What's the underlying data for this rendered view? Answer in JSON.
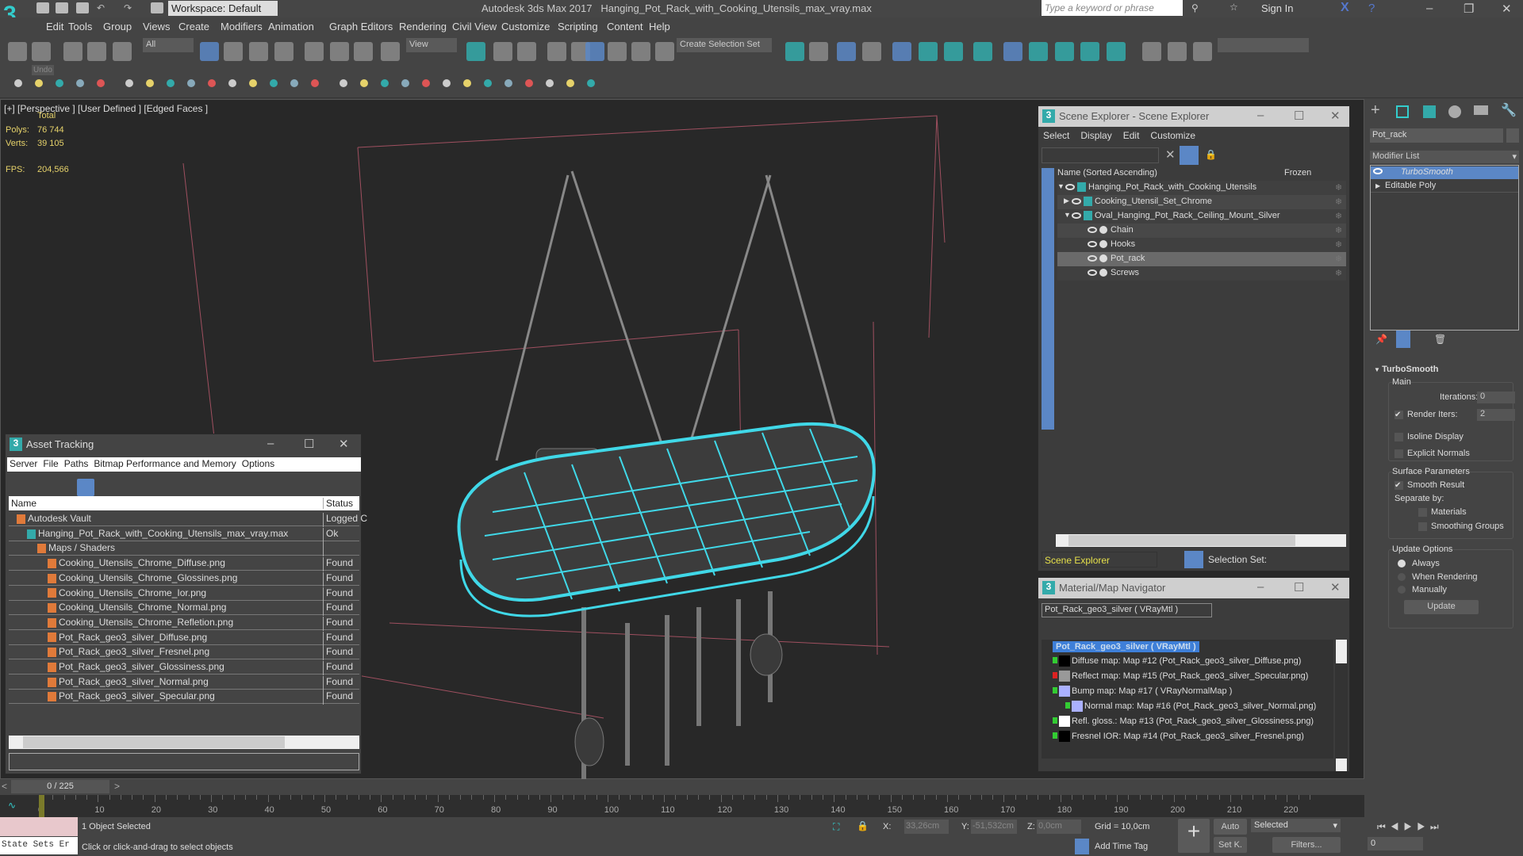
{
  "titlebar": {
    "workspace": "Workspace: Default",
    "app_title": "Autodesk 3ds Max 2017",
    "file_title": "Hanging_Pot_Rack_with_Cooking_Utensils_max_vray.max",
    "search_placeholder": "Type a keyword or phrase",
    "sign_in": "Sign In",
    "logo": "3"
  },
  "menu": [
    "Edit",
    "Tools",
    "Group",
    "Views",
    "Create",
    "Modifiers",
    "Animation",
    "Graph Editors",
    "Rendering",
    "Civil View",
    "Customize",
    "Scripting",
    "Content",
    "Help"
  ],
  "toolbar": {
    "filter": "All",
    "ref_coord": "View",
    "selection_set": "Create Selection Set",
    "undo_tooltip": "Undo"
  },
  "viewport": {
    "label": "[+] [Perspective ] [User Defined ] [Edged Faces ]",
    "total": "Total",
    "polys_label": "Polys:",
    "polys": "76 744",
    "verts_label": "Verts:",
    "verts": "39 105",
    "fps_label": "FPS:",
    "fps": "204,566"
  },
  "scene_explorer": {
    "title": "Scene Explorer - Scene Explorer",
    "menu": [
      "Select",
      "Display",
      "Edit",
      "Customize"
    ],
    "col_name": "Name (Sorted Ascending)",
    "col_frozen": "Frozen",
    "items": [
      {
        "name": "Hanging_Pot_Rack_with_Cooking_Utensils",
        "depth": 0
      },
      {
        "name": "Cooking_Utensil_Set_Chrome",
        "depth": 1
      },
      {
        "name": "Oval_Hanging_Pot_Rack_Ceiling_Mount_Silver",
        "depth": 1
      },
      {
        "name": "Chain",
        "depth": 2
      },
      {
        "name": "Hooks",
        "depth": 2
      },
      {
        "name": "Pot_rack",
        "depth": 2,
        "selected": true
      },
      {
        "name": "Screws",
        "depth": 2
      }
    ],
    "footer_dropdown": "Scene Explorer",
    "selection_set": "Selection Set:"
  },
  "material_nav": {
    "title": "Material/Map Navigator",
    "field": "Pot_Rack_geo3_silver  ( VRayMtl )",
    "root": "Pot_Rack_geo3_silver  ( VRayMtl )",
    "items": [
      "Diffuse map: Map #12 (Pot_Rack_geo3_silver_Diffuse.png)",
      "Reflect map: Map #15 (Pot_Rack_geo3_silver_Specular.png)",
      "Bump map: Map #17  ( VRayNormalMap )",
      "Normal map: Map #16 (Pot_Rack_geo3_silver_Normal.png)",
      "Refl. gloss.: Map #13 (Pot_Rack_geo3_silver_Glossiness.png)",
      "Fresnel IOR: Map #14 (Pot_Rack_geo3_silver_Fresnel.png)"
    ]
  },
  "asset_tracking": {
    "title": "Asset Tracking",
    "menu": [
      "Server",
      "File",
      "Paths",
      "Bitmap Performance and Memory",
      "Options"
    ],
    "col_name": "Name",
    "col_status": "Status",
    "rows": [
      {
        "name": "Autodesk Vault",
        "status": "Logged C",
        "depth": 0
      },
      {
        "name": "Hanging_Pot_Rack_with_Cooking_Utensils_max_vray.max",
        "status": "Ok",
        "depth": 1
      },
      {
        "name": "Maps / Shaders",
        "status": "",
        "depth": 2
      },
      {
        "name": "Cooking_Utensils_Chrome_Diffuse.png",
        "status": "Found",
        "depth": 3
      },
      {
        "name": "Cooking_Utensils_Chrome_Glossines.png",
        "status": "Found",
        "depth": 3
      },
      {
        "name": "Cooking_Utensils_Chrome_Ior.png",
        "status": "Found",
        "depth": 3
      },
      {
        "name": "Cooking_Utensils_Chrome_Normal.png",
        "status": "Found",
        "depth": 3
      },
      {
        "name": "Cooking_Utensils_Chrome_Refletion.png",
        "status": "Found",
        "depth": 3
      },
      {
        "name": "Pot_Rack_geo3_silver_Diffuse.png",
        "status": "Found",
        "depth": 3
      },
      {
        "name": "Pot_Rack_geo3_silver_Fresnel.png",
        "status": "Found",
        "depth": 3
      },
      {
        "name": "Pot_Rack_geo3_silver_Glossiness.png",
        "status": "Found",
        "depth": 3
      },
      {
        "name": "Pot_Rack_geo3_silver_Normal.png",
        "status": "Found",
        "depth": 3
      },
      {
        "name": "Pot_Rack_geo3_silver_Specular.png",
        "status": "Found",
        "depth": 3
      }
    ]
  },
  "command_panel": {
    "object_name": "Pot_rack",
    "modifier_list": "Modifier List",
    "stack": [
      "TurboSmooth",
      "Editable Poly"
    ],
    "rollout": {
      "title": "TurboSmooth",
      "main": "Main",
      "iterations_label": "Iterations:",
      "iterations": "0",
      "render_iters_label": "Render Iters:",
      "render_iters": "2",
      "render_iters_checked": true,
      "isoline": "Isoline Display",
      "explicit_normals": "Explicit Normals",
      "surface_params": "Surface Parameters",
      "smooth_result": "Smooth Result",
      "smooth_result_checked": true,
      "separate_by": "Separate by:",
      "materials": "Materials",
      "smoothing_groups": "Smoothing Groups",
      "update_options": "Update Options",
      "always": "Always",
      "when_rendering": "When Rendering",
      "manually": "Manually",
      "update_btn": "Update"
    }
  },
  "timeline": {
    "frame": "0 / 225",
    "ticks": [
      0,
      10,
      20,
      30,
      40,
      50,
      60,
      70,
      80,
      90,
      100,
      110,
      120,
      130,
      140,
      150,
      160,
      170,
      180,
      190,
      200,
      210,
      220
    ],
    "current": 0,
    "total": 225
  },
  "status": {
    "state_sets": "State Sets Er",
    "selected": "1 Object Selected",
    "prompt": "Click or click-and-drag to select objects",
    "x_label": "X:",
    "x": "33,26cm",
    "y_label": "Y:",
    "y": "-51,532cm",
    "z_label": "Z:",
    "z": "0,0cm",
    "grid": "Grid = 10,0cm",
    "add_time_tag": "Add Time Tag",
    "auto": "Auto",
    "set_key": "Set K.",
    "key_filter": "Selected",
    "filters": "Filters...",
    "frame_field": "0"
  },
  "colors": {
    "accent": "#5b87c6",
    "selection": "#40d8e8",
    "teal": "#35b5b5"
  }
}
